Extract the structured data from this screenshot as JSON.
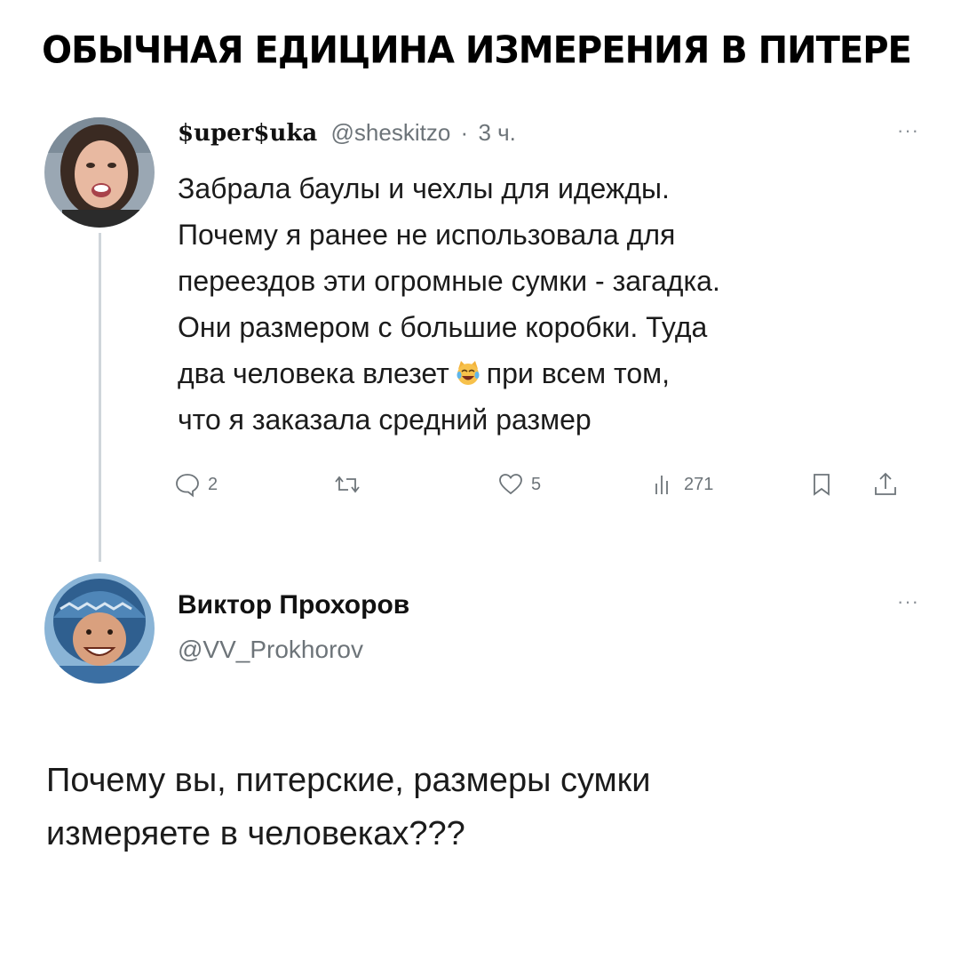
{
  "headline": "ОБЫЧНАЯ ЕДИЦИНА ИЗМЕРЕНИЯ В ПИТЕРЕ",
  "tweet1": {
    "display_name": "$uper$uka",
    "handle": "@sheskitzo",
    "separator": "·",
    "time": "3 ч.",
    "more": "···",
    "lines": [
      "Забрала баулы и чехлы для идежды.",
      "Почему я ранее не использовала для",
      "переездов эти огромные сумки - загадка.",
      "Они размером с большие коробки. Туда",
      "два человека влезет",
      "при всем том,",
      "что я заказала средний размер"
    ],
    "emoji": "laughing-cat-face",
    "actions": {
      "replies": "2",
      "retweets": "",
      "likes": "5",
      "views": "271"
    }
  },
  "tweet2": {
    "display_name": "Виктор Прохоров",
    "handle": "@VV_Prokhorov",
    "more": "···",
    "lines": [
      "Почему вы, питерские, размеры сумки",
      "измеряете в человеках???"
    ]
  },
  "colors": {
    "text": "#1b1b1b",
    "muted": "#6d7479",
    "thread_line": "#cfd5da"
  }
}
